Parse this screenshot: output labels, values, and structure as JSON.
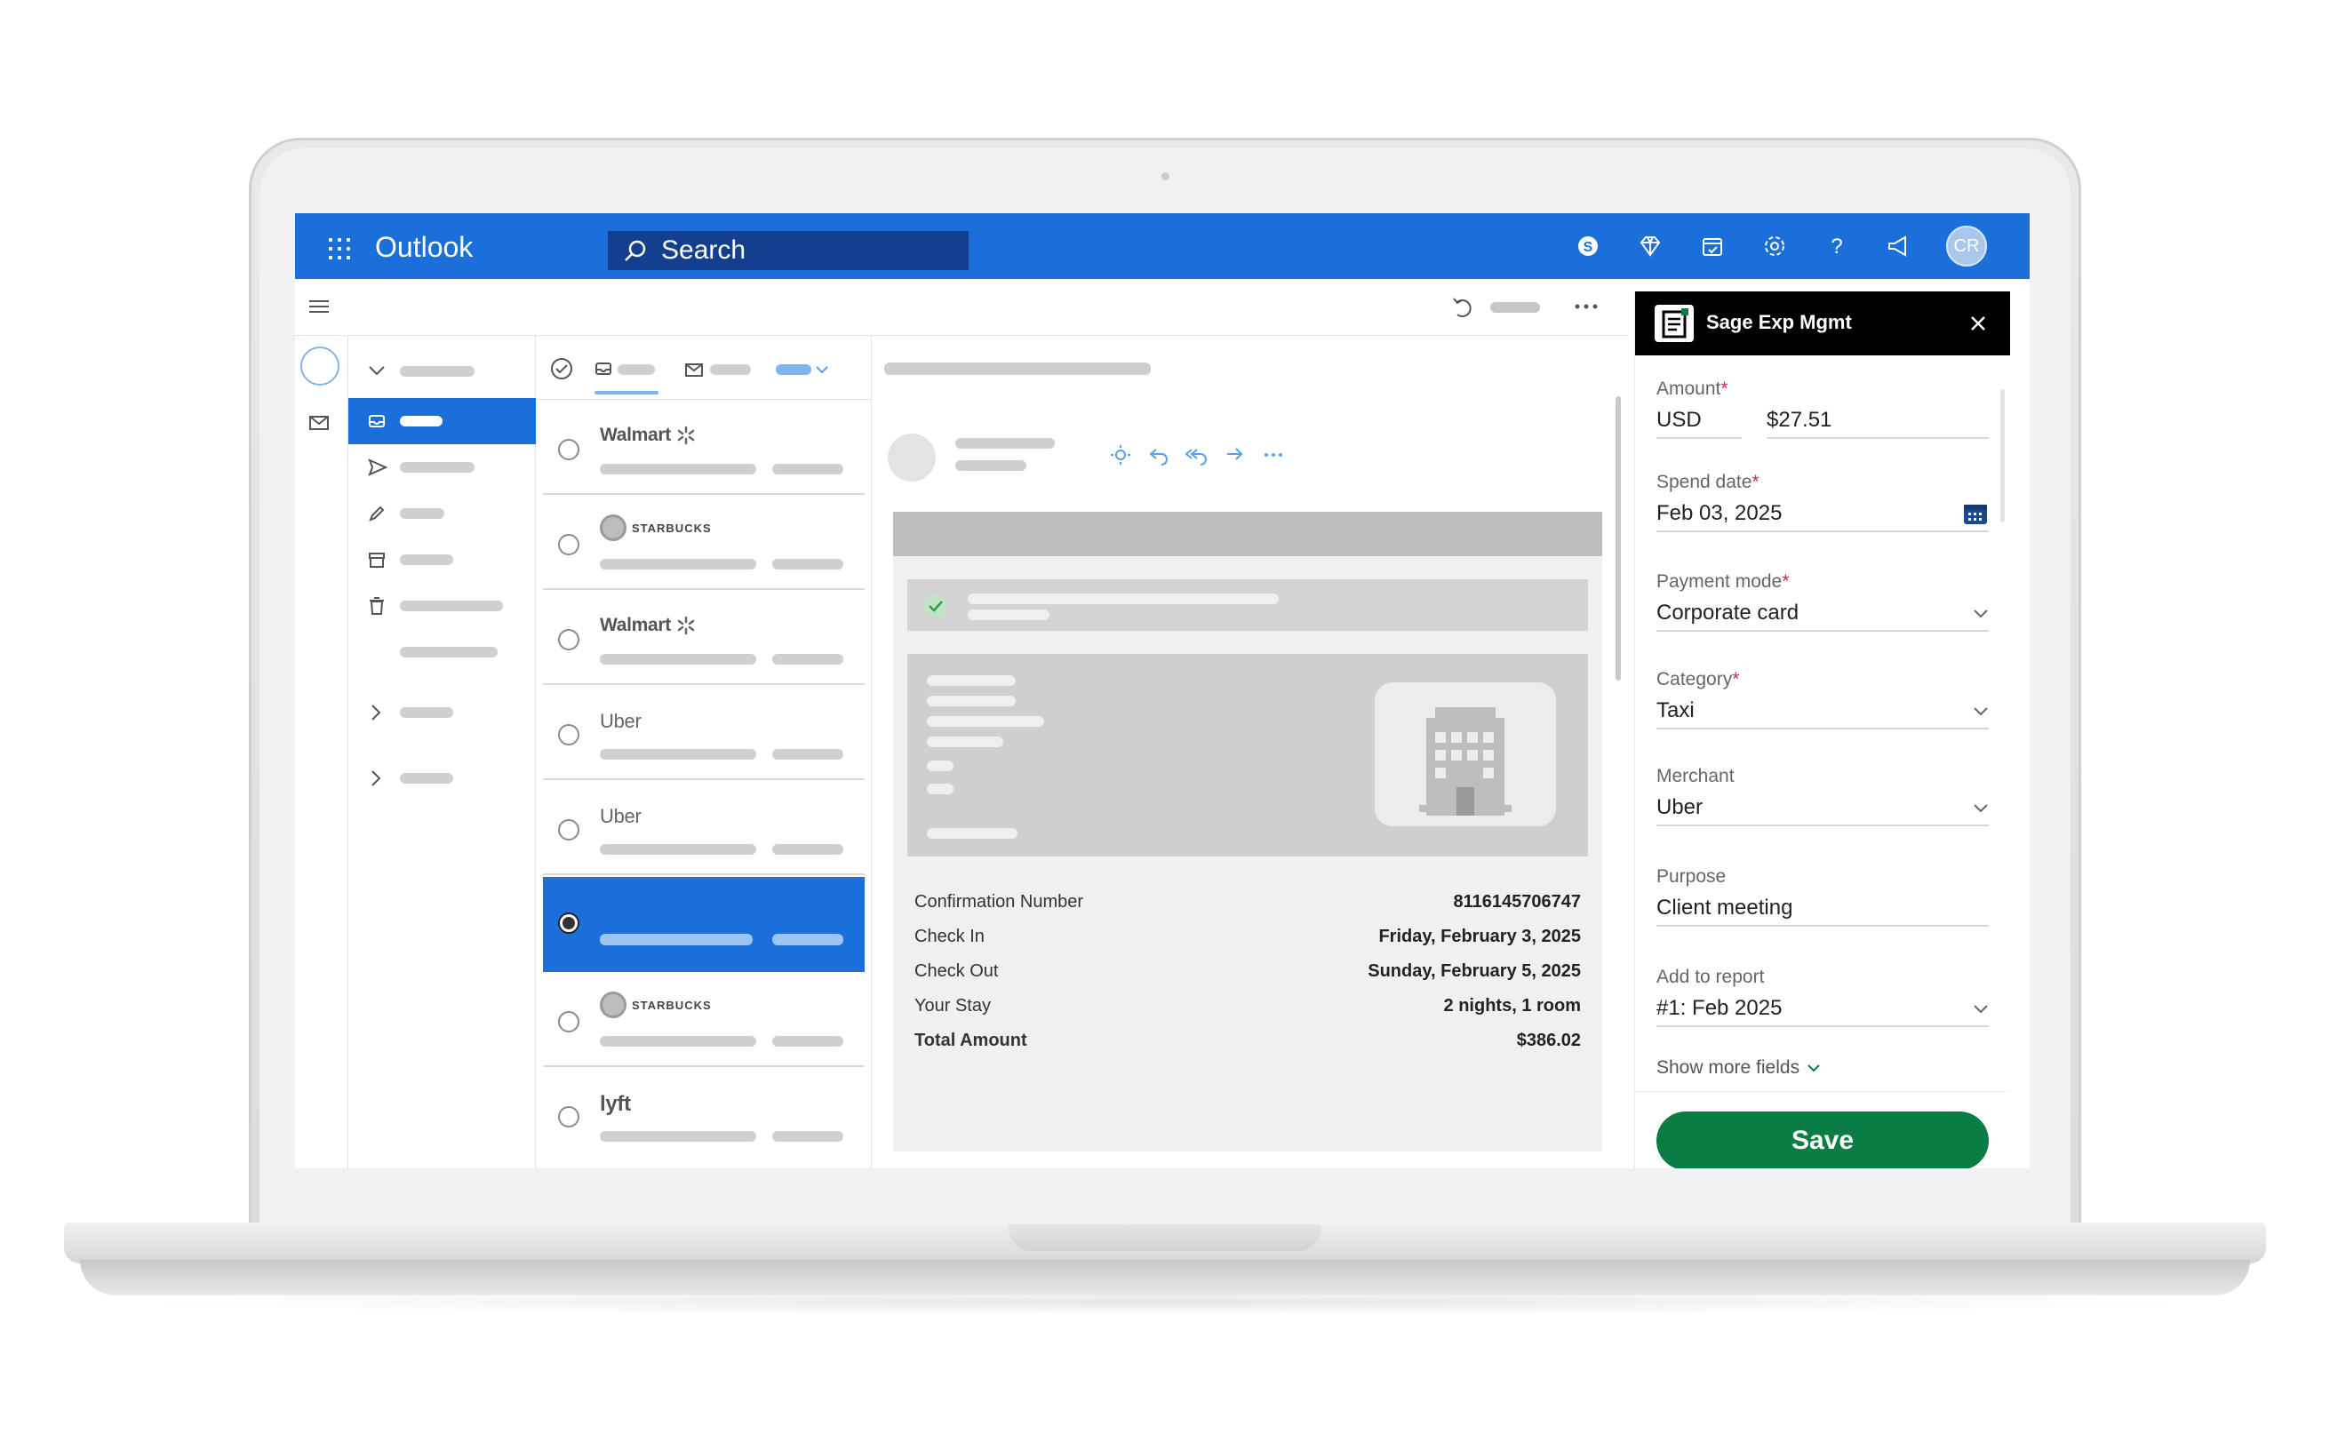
{
  "app": {
    "name": "Outlook",
    "avatar_initials": "CR"
  },
  "search": {
    "placeholder": "Search"
  },
  "messages": [
    {
      "sender": "Walmart"
    },
    {
      "sender": "STARBUCKS"
    },
    {
      "sender": "Walmart"
    },
    {
      "sender": "Uber"
    },
    {
      "sender": "Uber"
    },
    {
      "sender": ""
    },
    {
      "sender": "STARBUCKS"
    },
    {
      "sender": "lyft"
    }
  ],
  "confirmation": {
    "rows": [
      {
        "label": "Confirmation Number",
        "value": "8116145706747"
      },
      {
        "label": "Check In",
        "value": "Friday, February 3, 2025"
      },
      {
        "label": "Check Out",
        "value": "Sunday, February 5, 2025"
      },
      {
        "label": "Your Stay",
        "value": "2 nights, 1 room"
      },
      {
        "label": "Total Amount",
        "value": "$386.02"
      }
    ]
  },
  "addin": {
    "title": "Sage Exp Mgmt",
    "amount_label": "Amount",
    "currency": "USD",
    "amount": "$27.51",
    "spend_date_label": "Spend date",
    "spend_date": "Feb 03, 2025",
    "payment_mode_label": "Payment mode",
    "payment_mode": "Corporate card",
    "category_label": "Category",
    "category": "Taxi",
    "merchant_label": "Merchant",
    "merchant": "Uber",
    "purpose_label": "Purpose",
    "purpose": "Client meeting",
    "report_label": "Add to report",
    "report": "#1: Feb 2025",
    "required_mark": "*",
    "show_more": "Show more fields",
    "save": "Save"
  },
  "colors": {
    "brand_blue": "#1a6fd8",
    "save_green": "#0a7d45",
    "required_red": "#c0304a"
  }
}
